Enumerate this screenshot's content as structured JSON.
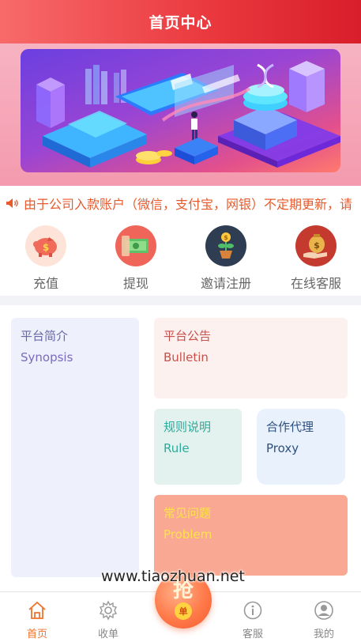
{
  "header": {
    "title": "首页中心"
  },
  "notice": {
    "text": "由于公司入款账户（微信，支付宝，网银）不定期更新，请"
  },
  "quick_actions": [
    {
      "label": "充值",
      "icon": "piggy-bank-icon"
    },
    {
      "label": "提现",
      "icon": "cash-icon"
    },
    {
      "label": "邀请注册",
      "icon": "money-plant-icon"
    },
    {
      "label": "在线客服",
      "icon": "money-bag-hand-icon"
    }
  ],
  "cards": {
    "synopsis": {
      "zh": "平台简介",
      "en": "Synopsis"
    },
    "bulletin": {
      "zh": "平台公告",
      "en": "Bulletin"
    },
    "rule": {
      "zh": "规则说明",
      "en": "Rule"
    },
    "proxy": {
      "zh": "合作代理",
      "en": "Proxy"
    },
    "problem": {
      "zh": "常见问题",
      "en": "Problem"
    }
  },
  "float_button": {
    "big": "抢",
    "small": "单"
  },
  "watermark": "www.tiaozhuan.net",
  "tabs": [
    {
      "label": "首页",
      "icon": "home-icon",
      "active": true
    },
    {
      "label": "收单",
      "icon": "gear-icon",
      "active": false
    },
    {
      "label": "客服",
      "icon": "info-icon",
      "active": false
    },
    {
      "label": "我的",
      "icon": "user-icon",
      "active": false
    }
  ],
  "colors": {
    "accent": "#f0722b",
    "header": "#e9373d"
  }
}
